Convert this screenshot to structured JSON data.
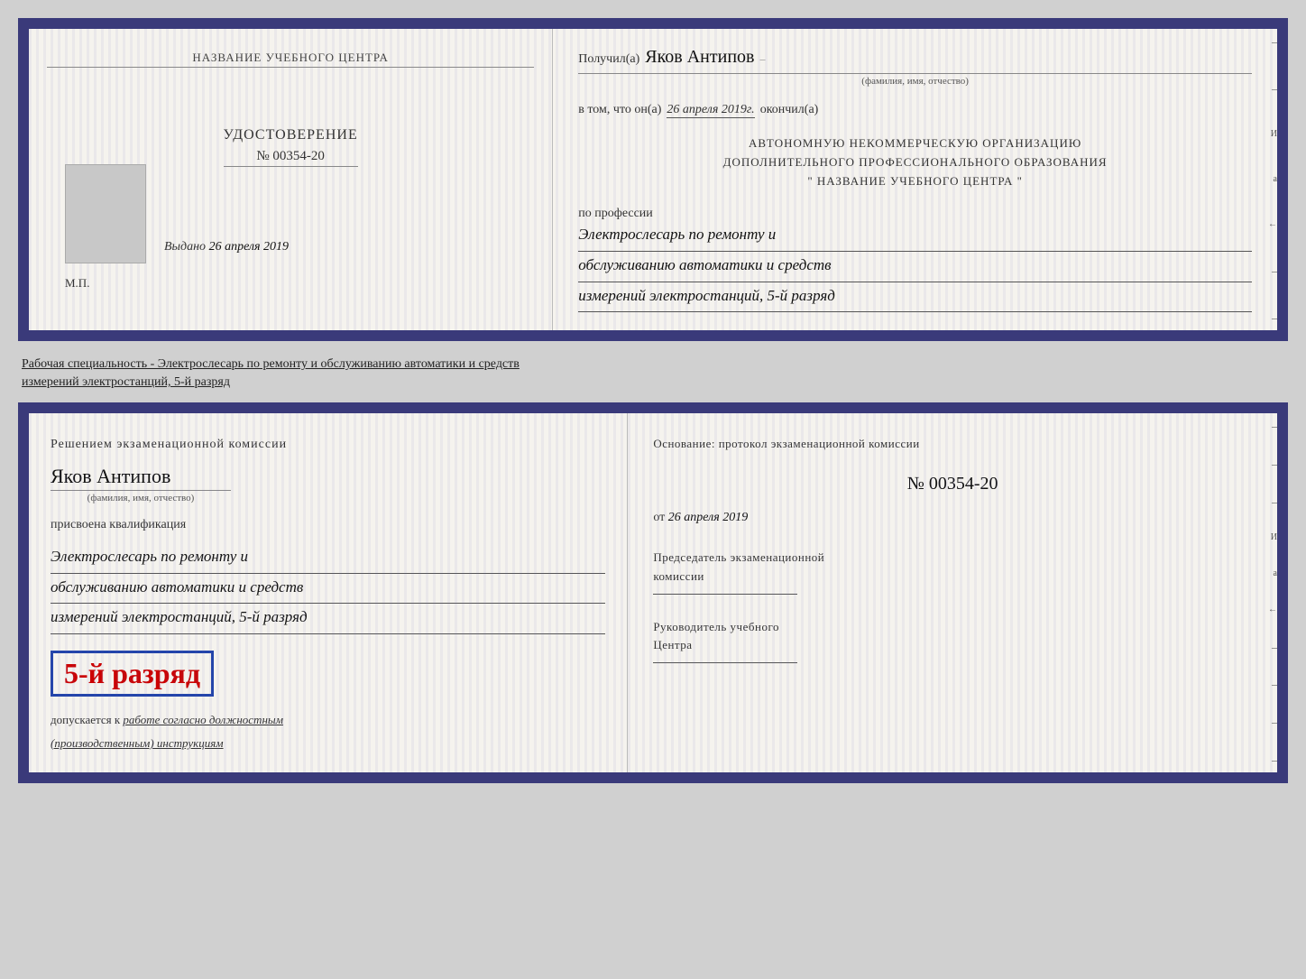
{
  "top_card": {
    "left": {
      "center_name": "НАЗВАНИЕ УЧЕБНОГО ЦЕНТРА",
      "title": "УДОСТОВЕРЕНИЕ",
      "number": "№ 00354-20",
      "vydano_label": "Выдано",
      "vydano_date": "26 апреля 2019",
      "mp_label": "М.П."
    },
    "right": {
      "poluchil_label": "Получил(а)",
      "recipient_name": "Яков Антипов",
      "fio_label": "(фамилия, имя, отчество)",
      "vtom_label": "в том, что он(а)",
      "date_text": "26 апреля 2019г.",
      "okonchil_label": "окончил(а)",
      "org_line1": "АВТОНОМНУЮ НЕКОММЕРЧЕСКУЮ ОРГАНИЗАЦИЮ",
      "org_line2": "ДОПОЛНИТЕЛЬНОГО ПРОФЕССИОНАЛЬНОГО ОБРАЗОВАНИЯ",
      "org_quote": "\"  НАЗВАНИЕ УЧЕБНОГО ЦЕНТРА  \"",
      "po_professii": "по профессии",
      "profession_line1": "Электрослесарь по ремонту и",
      "profession_line2": "обслуживанию автоматики и средств",
      "profession_line3": "измерений электростанций, 5-й разряд"
    }
  },
  "separator": {
    "text": "Рабочая специальность - Электрослесарь по ремонту и обслуживанию автоматики и средств",
    "text2": "измерений электростанций, 5-й разряд"
  },
  "bottom_card": {
    "left": {
      "komissia_line1": "Решением  экзаменационной  комиссии",
      "recipient_name": "Яков Антипов",
      "fio_label": "(фамилия, имя, отчество)",
      "prisvoena_label": "присвоена квалификация",
      "qual_line1": "Электрослесарь по ремонту и",
      "qual_line2": "обслуживанию автоматики и средств",
      "qual_line3": "измерений электростанций, 5-й разряд",
      "rank_bold": "5-й разряд",
      "dopuskaetsya_label": "допускается к",
      "dopuskaetsya_text": "работе согласно должностным",
      "dopuskaetsya_text2": "(производственным) инструкциям"
    },
    "right": {
      "osnovanie_label": "Основание: протокол экзаменационной  комиссии",
      "protocol_num": "№  00354-20",
      "ot_label": "от",
      "protocol_date": "26 апреля 2019",
      "predsedatel_label": "Председатель экзаменационной",
      "komissia_label": "комиссии",
      "rukovoditel_label": "Руководитель учебного",
      "centr_label": "Центра"
    }
  }
}
